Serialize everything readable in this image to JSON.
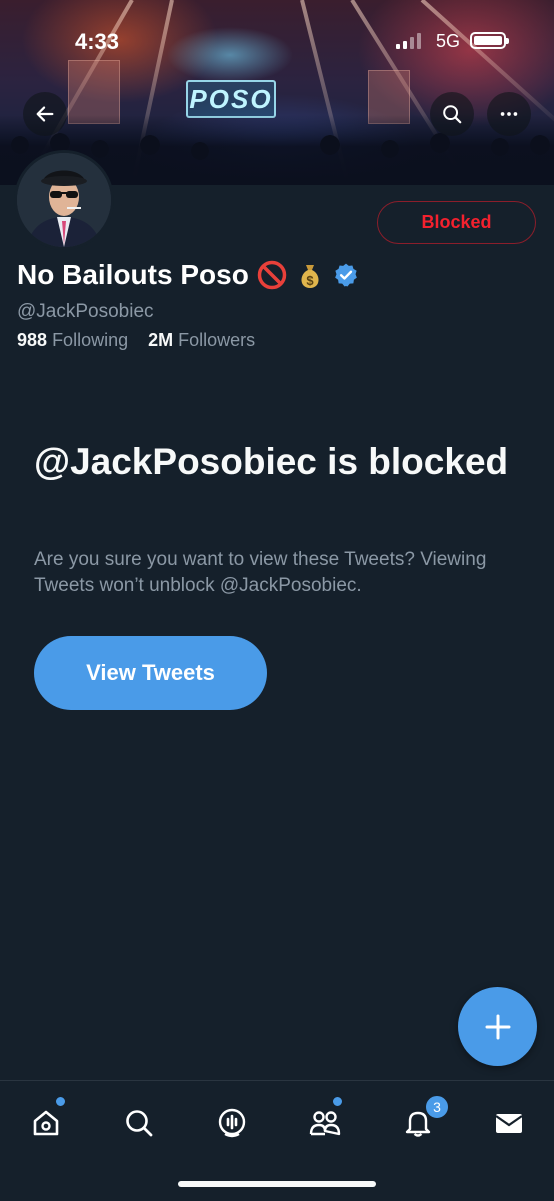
{
  "status_bar": {
    "time": "4:33",
    "network": "5G",
    "icons": [
      "signal-icon",
      "battery-icon"
    ]
  },
  "banner": {
    "sign_text": "POSO",
    "buttons": [
      "back-arrow-icon",
      "search-icon",
      "more-icon"
    ]
  },
  "profile": {
    "display_name": "No Bailouts Poso",
    "name_emojis": [
      "no-entry-icon",
      "money-bag-icon",
      "verified-icon"
    ],
    "handle": "@JackPosobiec",
    "following_count": "988",
    "following_label": "Following",
    "followers_count": "2M",
    "followers_label": "Followers",
    "blocked_button_label": "Blocked"
  },
  "block_notice": {
    "title": "@JackPosobiec is blocked",
    "description": "Are you sure you want to view these Tweets? Viewing Tweets won’t unblock @JackPosobiec.",
    "view_button_label": "View Tweets"
  },
  "fab": {
    "icon": "plus-icon"
  },
  "bottom_nav": {
    "items": [
      "home-icon",
      "search-icon",
      "spaces-icon",
      "communities-icon",
      "notifications-icon",
      "messages-icon"
    ],
    "notifications_badge": "3"
  },
  "colors": {
    "background": "#15202b",
    "accent": "#4a9be8",
    "blocked_red": "#f4212e",
    "secondary_text": "#8b98a5"
  }
}
